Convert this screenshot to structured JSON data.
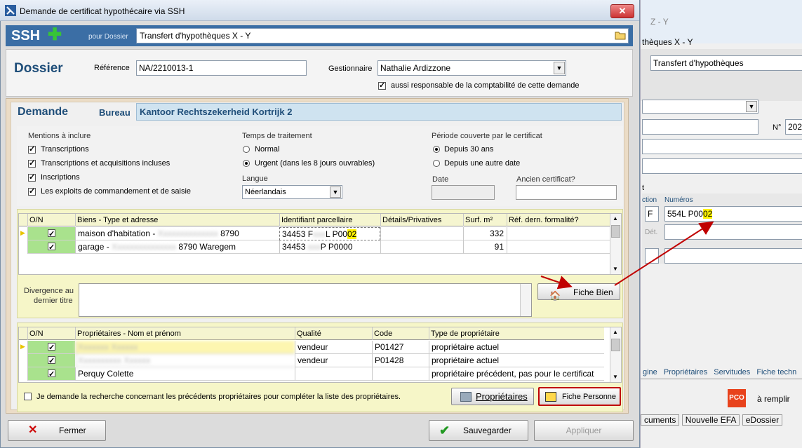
{
  "bg_window": {
    "title_frag": "Z - Y",
    "title_line": "thèques X - Y",
    "dossier_field": "Transfert d'hypothèques",
    "no_label": "N°",
    "no_value": "202",
    "section_frag": "t",
    "action_frag": "ction",
    "numeros_label": "Numéros",
    "action_value": "F",
    "numeros_value_pre": "554L P00",
    "numeros_value_hl": "02",
    "det_label": "Dét.",
    "tabs": [
      "gine",
      "Propriétaires",
      "Servitudes",
      "Fiche techn"
    ],
    "pco_badge": "PCO",
    "a_remplir": "à remplir",
    "bottom_tabs": [
      "cuments",
      "Nouvelle EFA",
      "eDossier"
    ]
  },
  "dialog": {
    "title": "Demande de certificat hypothécaire via SSH",
    "close": "✕",
    "logo": "SSH",
    "plus": "✚",
    "pour_dossier": "pour Dossier",
    "dossier_value": "Transfert d'hypothèques X - Y"
  },
  "dossier": {
    "heading": "Dossier",
    "reference_label": "Référence",
    "reference_value": "NA/2210013-1",
    "gestionnaire_label": "Gestionnaire",
    "gestionnaire_value": "Nathalie Ardizzone",
    "responsable_label": "aussi responsable de la comptabilité de cette demande"
  },
  "demande": {
    "heading": "Demande",
    "bureau_label": "Bureau",
    "bureau_value": "Kantoor Rechtszekerheid Kortrijk 2",
    "mentions_title": "Mentions à inclure",
    "mentions": [
      "Transcriptions",
      "Transcriptions et acquisitions incluses",
      "Inscriptions",
      "Les exploits de commandement et de saisie"
    ],
    "temps_title": "Temps de traitement",
    "temps_options": [
      "Normal",
      "Urgent (dans les 8 jours ouvrables)"
    ],
    "langue_label": "Langue",
    "langue_value": "Néerlandais",
    "periode_title": "Période couverte par le certificat",
    "periode_options": [
      "Depuis 30 ans",
      "Depuis une autre date"
    ],
    "date_label": "Date",
    "ancien_label": "Ancien certificat?"
  },
  "biens_table": {
    "headers": [
      "O/N",
      "Biens - Type et adresse",
      "Identifiant parcellaire",
      "Détails/Privatives",
      "Surf. m²",
      "Réf. dern. formalité?"
    ],
    "rows": [
      {
        "type": "maison d'habitation  -",
        "blur": "Xxxxxxxxxxxxxx",
        "addr": "8790",
        "ident_pre": "34453 F",
        "ident_blur": "xxx",
        "ident_post": "L P00",
        "ident_hl": "02",
        "surf": "332"
      },
      {
        "type": "garage  -",
        "blur": "Xxxxxxxxxxxxxxx",
        "addr": "8790 Waregem",
        "ident_pre": "34453 ",
        "ident_blur": "xxx",
        "ident_post": "P P0000",
        "ident_hl": "",
        "surf": "91"
      }
    ]
  },
  "divergence_label_1": "Divergence au",
  "divergence_label_2": "dernier titre",
  "fiche_bien": "Fiche Bien",
  "proprio_table": {
    "headers": [
      "O/N",
      "Propriétaires - Nom et prénom",
      "Qualité",
      "Code",
      "Type de propriétaire"
    ],
    "rows": [
      {
        "name": "Xxxxxxx Xxxxxx",
        "blur": true,
        "qualite": "vendeur",
        "code": "P01427",
        "type": "propriétaire actuel"
      },
      {
        "name": "Xxxxxxxxxx Xxxxxx",
        "blur": true,
        "qualite": "vendeur",
        "code": "P01428",
        "type": "propriétaire actuel"
      },
      {
        "name": "Perquy Colette",
        "blur": false,
        "qualite": "",
        "code": "",
        "type": "propriétaire précédent, pas pour le certificat"
      }
    ]
  },
  "recherche_label": "Je demande la recherche concernant les précédents propriétaires pour compléter la liste des propriétaires.",
  "proprietaires_btn": "Propriétaires",
  "fiche_personne": "Fiche Personne",
  "footer": {
    "fermer": "Fermer",
    "sauvegarder": "Sauvegarder",
    "appliquer": "Appliquer"
  },
  "colors": {
    "accent": "#1f4e79",
    "highlight": "#fff200",
    "arrow": "#c00000"
  }
}
